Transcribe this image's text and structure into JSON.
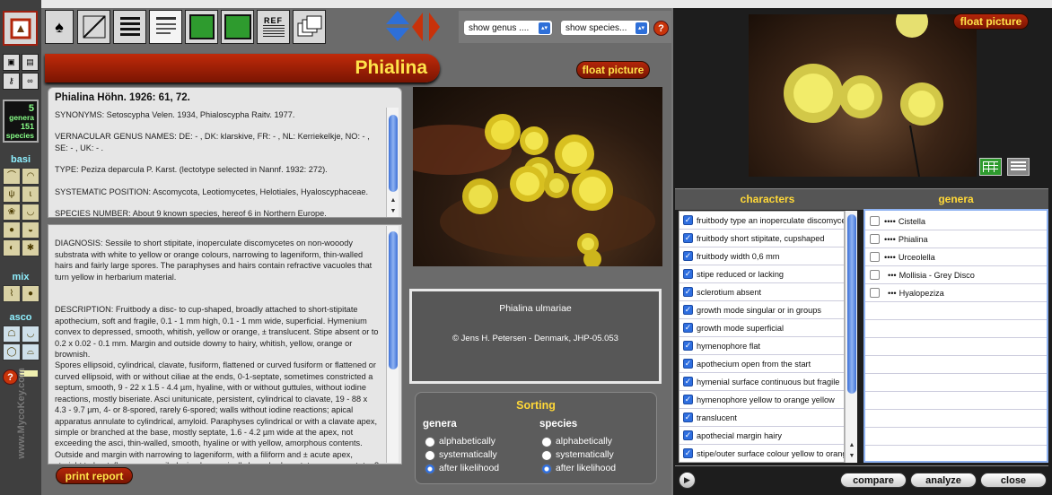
{
  "toolbar": {
    "ref_label": "REF",
    "genus_select": "show genus ....",
    "species_select": "show species...",
    "help_label": "?"
  },
  "sidebar": {
    "genera_count": "5",
    "genera_label": "genera",
    "species_count": "151",
    "species_label": "species",
    "section_basi": "basi",
    "section_mix": "mix",
    "section_asco": "asco",
    "help_label": "?",
    "watermark": "www.MycoKey.com"
  },
  "main": {
    "title": "Phialina",
    "float_picture": "float picture",
    "header": "Phialina Höhn. 1926: 61, 72.",
    "info_paragraphs": [
      "SYNONYMS: Setoscypha Velen. 1934, Phialoscypha Raitv. 1977.",
      "VERNACULAR GENUS NAMES: DE: - , DK: klarskive, FR: - , NL: Kerriekelkje, NO: - , SE: - , UK: - .",
      "TYPE: Peziza deparcula P. Karst. (lectotype selected in Nannf. 1932: 272).",
      "SYSTEMATIC POSITION: Ascomycota, Leotiomycetes, Helotiales, Hyaloscyphaceae.",
      "SPECIES NUMBER: About 9 known species, hereof 6 in Northern Europe."
    ],
    "description_paragraphs": [
      "DIAGNOSIS: Sessile to short stipitate, inoperculate discomycetes on non-wooody substrata with white to yellow or orange colours, narrowing to lageniform, thin-walled hairs and fairly large spores. The paraphyses and hairs contain refractive vacuoles that turn yellow in herbarium material.",
      "DESCRIPTION: Fruitbody a disc- to cup-shaped, broadly attached to short-stipitate apothecium, soft and fragile, 0.1 - 1 mm high, 0.1 - 1 mm wide, superficial. Hymenium convex to depressed, smooth, whitish, yellow or orange, ± translucent. Stipe absent or to 0.2 x 0.02 - 0.1 mm. Margin and outside downy to hairy, whitish, yellow, orange or brownish.\n   Spores ellipsoid, cylindrical, clavate, fusiform, flattened or curved fusiform or flattened or curved ellipsoid, with or without ciliae at the ends, 0-1-septate, sometimes constricted a septum, smooth, 9  - 22 x 1.5 - 4.4 µm, hyaline, with or without guttules, without iodine reactions, mostly biseriate. Asci unitunicate, persistent, cylindrical to clavate, 19 - 88 x 4.3 - 9.7 µm, 4- or 8-spored, rarely 6-spored; walls without iodine reactions; apical apparatus annulate to cylindrical, amyloid. Paraphyses cylindrical or with a clavate apex, simple or branched at the base, mostly septate, 1.6 - 4.2 µm wide at the apex, not exceeding the asci, thin-walled, smooth, hyaline or with yellow, amorphous contents. Outside and margin with narrowing to lageniform, with a filiform and ± acute apex, straight to bent, flexuous or coiled, simple or apically branched, septate or non-septate, 8 - 130 x 2 - 4 µm large hairs, thin-walled, but sometimes with solidified apex, projecting; walls"
    ],
    "print_report": "print report",
    "caption_name": "Phialina ulmariae",
    "caption_credit": "© Jens H. Petersen - Denmark, JHP-05.053",
    "sorting": {
      "title": "Sorting",
      "genera_heading": "genera",
      "species_heading": "species",
      "options": [
        "alphabetically",
        "systematically",
        "after likelihood"
      ],
      "selected": "after likelihood"
    }
  },
  "right": {
    "float_picture": "float picture",
    "characters_heading": "characters",
    "genera_heading": "genera",
    "characters": [
      "fruitbody type an inoperculate discomycete",
      "fruitbody short stipitate, cupshaped",
      "fruitbody width 0,6 mm",
      "stipe reduced or lacking",
      "sclerotium absent",
      "growth mode singular or in groups",
      "growth mode superficial",
      "hymenophore flat",
      "apothecium open from the start",
      "hymenial surface continuous but fragile",
      "hymenophore yellow to orange yellow",
      "translucent",
      "apothecial margin hairy",
      "stipe/outer surface colour yellow to orange"
    ],
    "genera": [
      {
        "rank": "••••",
        "name": "Cistella"
      },
      {
        "rank": "••••",
        "name": "Phialina"
      },
      {
        "rank": "••••",
        "name": "Urceolella"
      },
      {
        "rank": "•••",
        "name": "Mollisia - Grey Disco"
      },
      {
        "rank": "•••",
        "name": "Hyalopeziza"
      }
    ],
    "compare": "compare",
    "analyze": "analyze",
    "close": "close",
    "play_icon": "▶"
  }
}
